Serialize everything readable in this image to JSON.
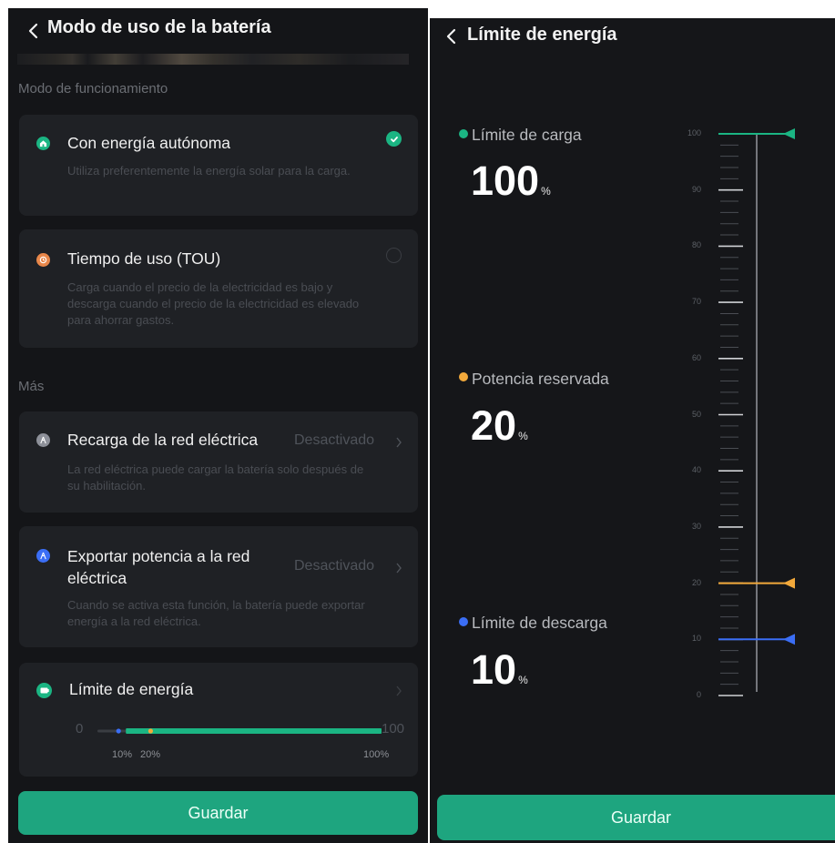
{
  "left": {
    "title": "Modo de uso de la batería",
    "section_operation": "Modo de funcionamiento",
    "self_powered": {
      "title": "Con energía autónoma",
      "desc": "Utiliza preferentemente la energía solar para la carga.",
      "selected": true
    },
    "tou": {
      "title": "Tiempo de uso (TOU)",
      "desc": "Carga cuando el precio de la electricidad es bajo y descarga cuando el precio de la electricidad es elevado para ahorrar gastos.",
      "selected": false
    },
    "section_more": "Más",
    "grid_charge": {
      "title": "Recarga de la red eléctrica",
      "value": "Desactivado",
      "desc": "La red eléctrica puede cargar la batería solo después de su habilitación."
    },
    "export": {
      "title_line1": "Exportar potencia a la red",
      "title_line2": "eléctrica",
      "value": "Desactivado",
      "desc": "Cuando se activa esta función, la batería puede exportar energía a la red eléctrica."
    },
    "energy_limit": {
      "title": "Límite de energía",
      "min_label": "0",
      "max_label": "100",
      "discharge_pct": "10%",
      "reserve_pct": "20%",
      "charge_pct": "100%",
      "discharge_value": 10,
      "reserve_value": 20,
      "charge_value": 100
    },
    "save_label": "Guardar"
  },
  "right": {
    "title": "Límite de energía",
    "charge_limit": {
      "label": "Límite de carga",
      "value": "100",
      "unit": "%"
    },
    "reserved": {
      "label": "Potencia reservada",
      "value": "20",
      "unit": "%"
    },
    "discharge_limit": {
      "label": "Límite de descarga",
      "value": "10",
      "unit": "%"
    },
    "scale_ticks": [
      "100",
      "90",
      "80",
      "70",
      "60",
      "50",
      "40",
      "30",
      "20",
      "10",
      "0"
    ],
    "save_label": "Guardar"
  },
  "colors": {
    "charge": "#1bb583",
    "reserve": "#f2a93b",
    "discharge": "#3b6ef5",
    "button": "#1ea57f"
  }
}
